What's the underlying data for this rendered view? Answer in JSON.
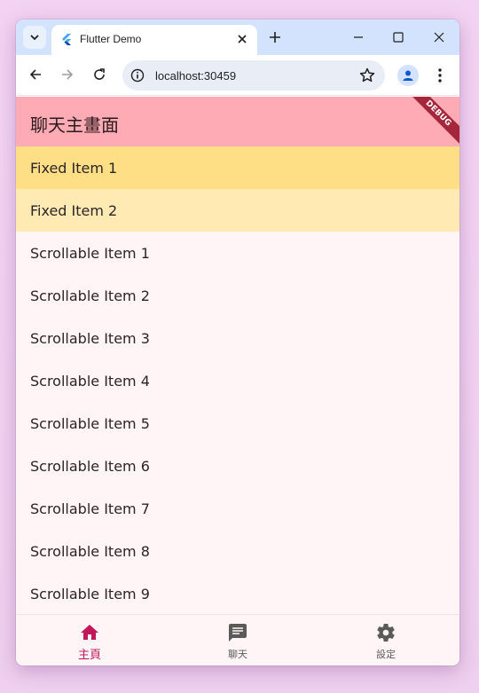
{
  "browser": {
    "tab_title": "Flutter Demo",
    "url": "localhost:30459"
  },
  "app": {
    "title": "聊天主畫面",
    "debug_banner": "DEBUG",
    "fixed_items": [
      "Fixed Item 1",
      "Fixed Item 2"
    ],
    "scrollable_items": [
      "Scrollable Item 1",
      "Scrollable Item 2",
      "Scrollable Item 3",
      "Scrollable Item 4",
      "Scrollable Item 5",
      "Scrollable Item 6",
      "Scrollable Item 7",
      "Scrollable Item 8",
      "Scrollable Item 9"
    ],
    "bottom_nav": [
      {
        "label": "主頁",
        "icon": "home-icon",
        "active": true
      },
      {
        "label": "聊天",
        "icon": "chat-icon",
        "active": false
      },
      {
        "label": "設定",
        "icon": "settings-icon",
        "active": false
      }
    ]
  },
  "colors": {
    "appbar": "#ffabb6",
    "fixed_item_1": "#ffdf85",
    "fixed_item_2": "#ffeab3",
    "active_nav": "#c2185b",
    "background": "#fff5f6"
  }
}
